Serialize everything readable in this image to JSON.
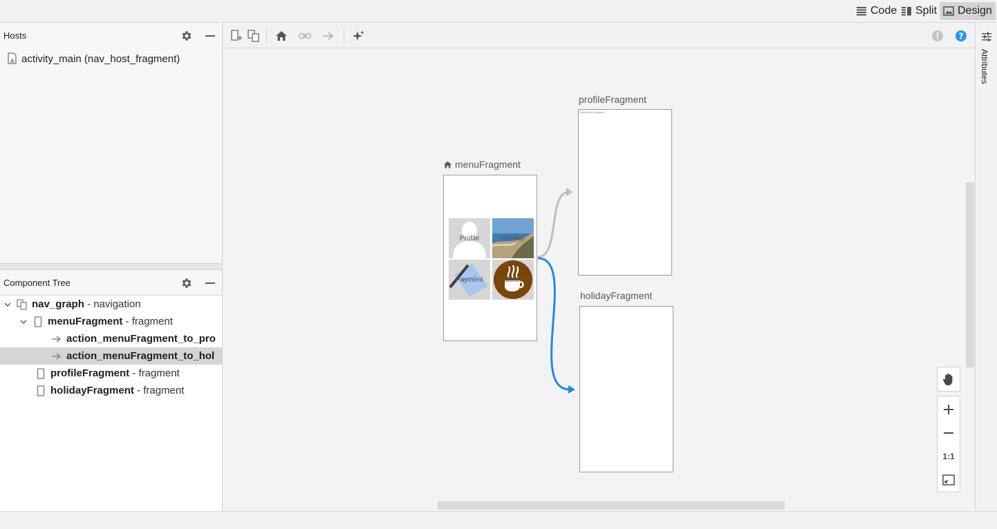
{
  "mode_bar": {
    "code_label": "Code",
    "split_label": "Split",
    "design_label": "Design",
    "active_mode": "Design"
  },
  "hosts_panel": {
    "title": "Hosts",
    "items": [
      {
        "label": "activity_main (nav_host_fragment)",
        "icon": "layout-file-icon"
      }
    ]
  },
  "component_tree": {
    "title": "Component Tree",
    "rows": [
      {
        "name": "nav_graph",
        "kind": "- navigation",
        "icon": "nav-graph-icon",
        "expanded": true
      },
      {
        "name": "menuFragment",
        "kind": "- fragment",
        "icon": "fragment-icon",
        "expanded": true
      },
      {
        "name": "action_menuFragment_to_pro",
        "kind": "",
        "icon": "action-arrow-icon"
      },
      {
        "name": "action_menuFragment_to_hol",
        "kind": "",
        "icon": "action-arrow-icon",
        "selected": true
      },
      {
        "name": "profileFragment",
        "kind": "- fragment",
        "icon": "fragment-icon"
      },
      {
        "name": "holidayFragment",
        "kind": "- fragment",
        "icon": "fragment-icon"
      }
    ]
  },
  "canvas": {
    "start_destination": "menuFragment",
    "destinations": {
      "menu": {
        "label": "menuFragment",
        "is_start": true
      },
      "profile": {
        "label": "profileFragment",
        "preview_text": "Hello blank fragment"
      },
      "holiday": {
        "label": "holidayFragment"
      }
    },
    "menu_tiles": {
      "profile": "Profile",
      "holiday": "Holiday",
      "payment": "Payment",
      "cafeteria": "Cafeteria"
    },
    "actions": [
      {
        "from": "menuFragment",
        "to": "profileFragment",
        "selected": false
      },
      {
        "from": "menuFragment",
        "to": "holidayFragment",
        "selected": true
      }
    ],
    "colors": {
      "selected_action": "#1e88e5",
      "action": "#bdbdbd",
      "help_icon": "#2196f3",
      "add_icon_plus": "#4caf50"
    }
  },
  "zoom": {
    "actual_size_label": "1:1"
  },
  "right_panel": {
    "attributes_label": "Attributes"
  }
}
